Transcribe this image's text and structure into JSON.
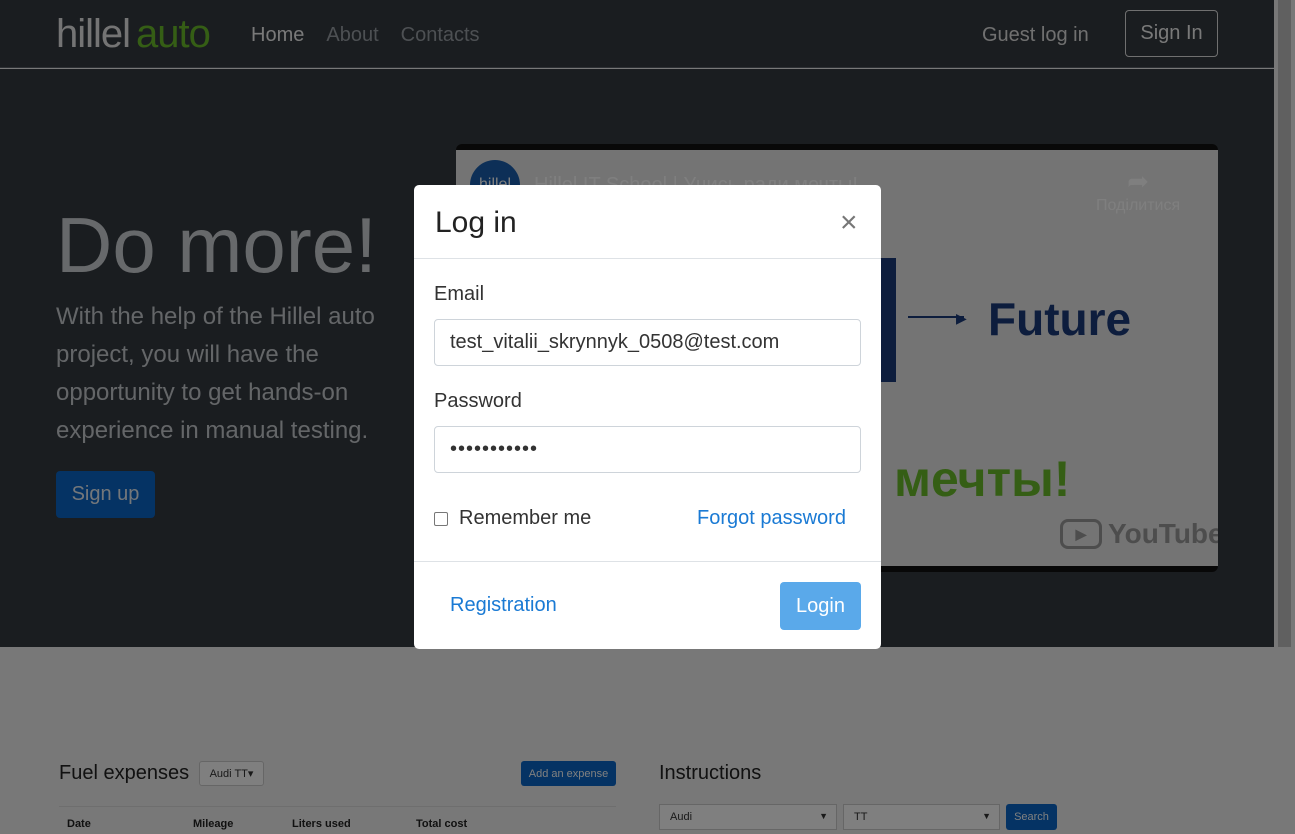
{
  "header": {
    "logo_main": "hillel",
    "logo_accent": "auto",
    "nav": [
      {
        "label": "Home"
      },
      {
        "label": "About"
      },
      {
        "label": "Contacts"
      }
    ],
    "guest_login": "Guest log in",
    "sign_in": "Sign In"
  },
  "hero": {
    "title": "Do more!",
    "text": "With the help of the Hillel auto project, you will have the opportunity to get hands-on experience in manual testing.",
    "signup": "Sign up",
    "video": {
      "channel": "hillel",
      "title": "Hillel IT School | Учись ради мечты!",
      "share": "Поділитися",
      "future": "Future",
      "dreams": "мечты!",
      "youtube": "YouTube"
    }
  },
  "fuel": {
    "title": "Fuel expenses",
    "car": "Audi TT",
    "add_button": "Add an expense",
    "columns": [
      "Date",
      "Mileage",
      "Liters used",
      "Total cost"
    ]
  },
  "instructions": {
    "title": "Instructions",
    "brand": "Audi",
    "model": "TT",
    "search": "Search"
  },
  "modal": {
    "title": "Log in",
    "close": "×",
    "email_label": "Email",
    "email_value": "test_vitalii_skrynnyk_0508@test.com",
    "password_label": "Password",
    "password_value": "•••••••••••",
    "remember_me": "Remember me",
    "forgot_password": "Forgot password",
    "registration": "Registration",
    "login": "Login"
  },
  "colors": {
    "header_bg": "#343a40",
    "accent_green": "#6bbd2a",
    "primary_blue": "#0a67c8",
    "link_blue": "#1a7ad4",
    "login_button": "#5aa9ea"
  }
}
